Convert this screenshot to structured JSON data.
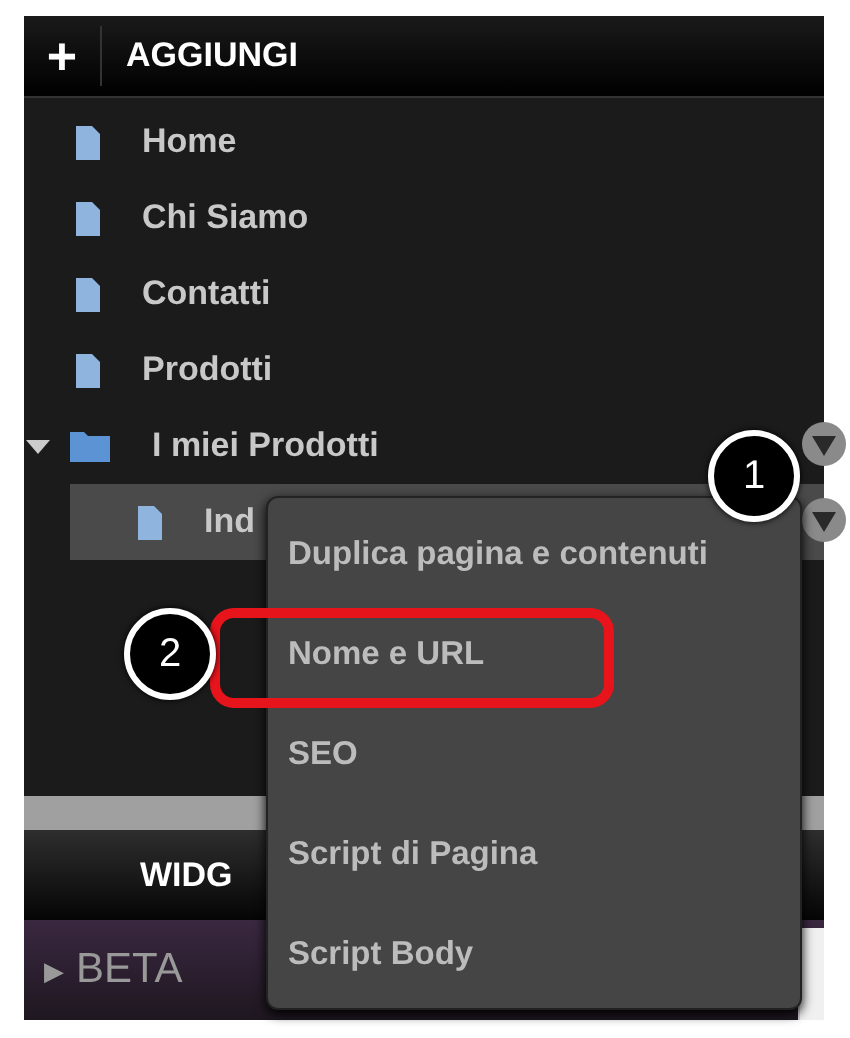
{
  "header": {
    "icon": "+",
    "label": "AGGIUNGI"
  },
  "tree": [
    {
      "label": "Home",
      "kind": "page",
      "selected": false
    },
    {
      "label": "Chi Siamo",
      "kind": "page",
      "selected": false
    },
    {
      "label": "Contatti",
      "kind": "page",
      "selected": false
    },
    {
      "label": "Prodotti",
      "kind": "page",
      "selected": false
    },
    {
      "label": "I miei Prodotti",
      "kind": "folder",
      "selected": false,
      "expanded": true,
      "children": [
        {
          "label": "Ind",
          "kind": "page",
          "selected": true
        }
      ]
    }
  ],
  "widgets_header": {
    "label": "WIDG"
  },
  "beta": {
    "arrow": "▶",
    "label": "BETA"
  },
  "context_menu": {
    "items": [
      {
        "label": "Duplica pagina e contenuti",
        "highlighted": false
      },
      {
        "label": "Nome e URL",
        "highlighted": true
      },
      {
        "label": "SEO",
        "highlighted": false
      },
      {
        "label": "Script di Pagina",
        "highlighted": false
      },
      {
        "label": "Script Body",
        "highlighted": false
      }
    ]
  },
  "callouts": [
    {
      "number": "1"
    },
    {
      "number": "2"
    }
  ]
}
